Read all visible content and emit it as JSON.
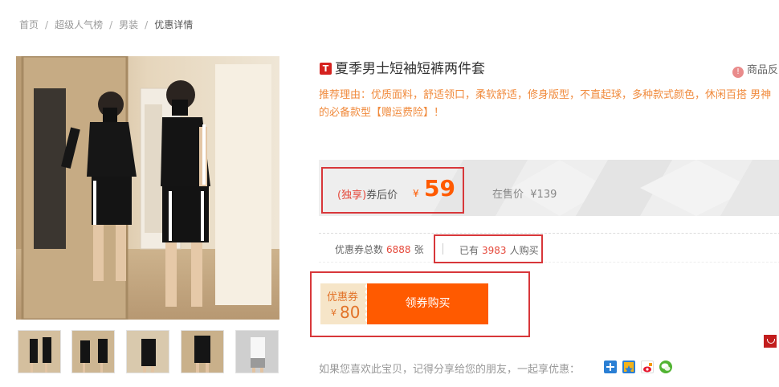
{
  "breadcrumb": {
    "items": [
      "首页",
      "超级人气榜",
      "男装",
      "优惠详情"
    ],
    "separator": "/"
  },
  "product": {
    "platform_badge": "T",
    "title": "夏季男士短袖短裤两件套",
    "report_label": "商品反",
    "reason": "推荐理由：优质面料，舒适领口，柔软舒适，修身版型，不直起球，多种款式颜色，休闲百搭 男神的必备款型【赠运费险】！"
  },
  "price": {
    "label_exclusive": "(独享)",
    "label_after_coupon": "券后价",
    "currency": "¥",
    "value": "59",
    "original_label": "在售价",
    "original_value": "¥139"
  },
  "stats": {
    "coupon_total_label": "优惠券总数",
    "coupon_total": "6888",
    "coupon_total_unit": "张",
    "sold_prefix": "已有",
    "sold_count": "3983",
    "sold_suffix": "人购买"
  },
  "coupon": {
    "label": "优惠券",
    "currency": "¥",
    "amount": "80",
    "button_label": "领券购买"
  },
  "share": {
    "text": "如果您喜欢此宝贝，记得分享给您的朋友，一起享优惠：",
    "icons": [
      "qq-zone-icon",
      "pengyou-icon",
      "weibo-icon",
      "wechat-icon"
    ]
  },
  "colors": {
    "accent": "#ff5a00",
    "highlight_border": "#d8373a",
    "coupon_bg": "#f6e5c8",
    "reason_text": "#f08a3c"
  }
}
